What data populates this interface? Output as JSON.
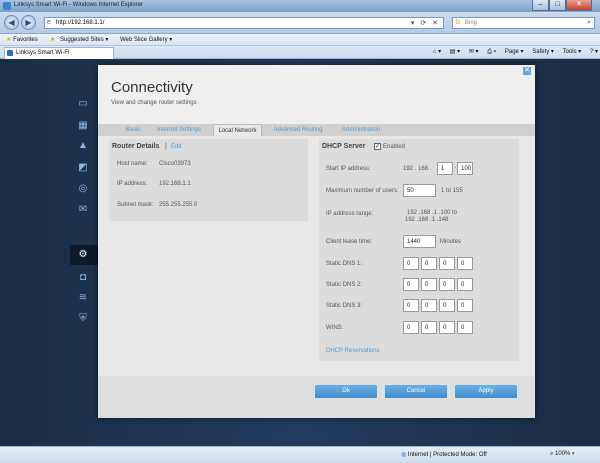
{
  "window": {
    "title": "Linksys Smart Wi-Fi - Windows Internet Explorer"
  },
  "browser": {
    "url": "http://192.168.1.1/",
    "search_placeholder": "Bing",
    "favorites_label": "Favorites",
    "fav_items": [
      "Suggested Sites ▾",
      "Web Slice Gallery ▾"
    ],
    "tab_label": "Linksys Smart Wi-Fi",
    "commands": [
      "Page ▾",
      "Safety ▾",
      "Tools ▾"
    ]
  },
  "sidebar": {
    "icons": [
      "network-map-icon",
      "wifi-settings-icon",
      "alert-icon",
      "parental-controls-icon",
      "media-prioritization-icon",
      "email-icon",
      "connectivity-icon",
      "camera-icon",
      "wireless-icon",
      "security-shield-icon"
    ],
    "active": "connectivity-icon"
  },
  "dialog": {
    "title": "Connectivity",
    "subtitle": "View and change router settings",
    "tabs": [
      {
        "label": "Basic",
        "active": false
      },
      {
        "label": "Internet Settings",
        "active": false
      },
      {
        "label": "Local Network",
        "active": true
      },
      {
        "label": "Advanced Routing",
        "active": false
      },
      {
        "label": "Administration",
        "active": false
      }
    ]
  },
  "router_details": {
    "heading": "Router Details",
    "separator": "|",
    "edit_label": "Edit",
    "rows": [
      {
        "label": "Host name:",
        "value": "Cisco03973"
      },
      {
        "label": "IP address:",
        "value": "192.168.1.1"
      },
      {
        "label": "Subnet mask:",
        "value": "255.255.255.0"
      }
    ]
  },
  "dhcp": {
    "heading": "DHCP Server",
    "enabled_label": "Enabled",
    "enabled": true,
    "start_ip_label": "Start IP address:",
    "start_ip_prefix": "192 . 168 .",
    "start_ip_octet3": "1",
    "start_ip_octet4": "100",
    "max_users_label": "Maximum number of users:",
    "max_users_value": "50",
    "max_users_range": "1 to 155",
    "ip_range_label": "IP address range:",
    "ip_range_start": "192 .168 .1 .100  to",
    "ip_range_end": "192 .168 .1 .148",
    "lease_label": "Client lease time:",
    "lease_value": "1440",
    "lease_unit": "Minutes",
    "dns1_label": "Static DNS 1:",
    "dns2_label": "Static DNS 2:",
    "dns3_label": "Static DNS 3:",
    "wins_label": "WINS:",
    "octet_value": "0",
    "reservations_label": "DHCP Reservations"
  },
  "buttons": {
    "ok": "Ok",
    "cancel": "Cancel",
    "apply": "Apply"
  },
  "statusbar": {
    "zone": "Internet | Protected Mode: Off",
    "zoom": "100%"
  }
}
